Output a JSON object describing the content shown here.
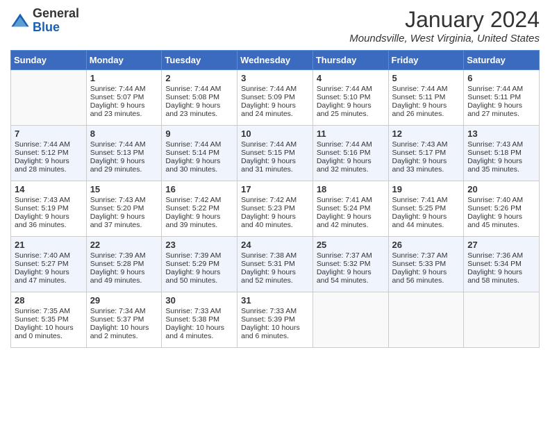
{
  "header": {
    "logo_general": "General",
    "logo_blue": "Blue",
    "month_title": "January 2024",
    "location": "Moundsville, West Virginia, United States"
  },
  "days_of_week": [
    "Sunday",
    "Monday",
    "Tuesday",
    "Wednesday",
    "Thursday",
    "Friday",
    "Saturday"
  ],
  "weeks": [
    [
      {
        "day": "",
        "empty": true
      },
      {
        "day": "1",
        "sunrise": "Sunrise: 7:44 AM",
        "sunset": "Sunset: 5:07 PM",
        "daylight": "Daylight: 9 hours and 23 minutes."
      },
      {
        "day": "2",
        "sunrise": "Sunrise: 7:44 AM",
        "sunset": "Sunset: 5:08 PM",
        "daylight": "Daylight: 9 hours and 23 minutes."
      },
      {
        "day": "3",
        "sunrise": "Sunrise: 7:44 AM",
        "sunset": "Sunset: 5:09 PM",
        "daylight": "Daylight: 9 hours and 24 minutes."
      },
      {
        "day": "4",
        "sunrise": "Sunrise: 7:44 AM",
        "sunset": "Sunset: 5:10 PM",
        "daylight": "Daylight: 9 hours and 25 minutes."
      },
      {
        "day": "5",
        "sunrise": "Sunrise: 7:44 AM",
        "sunset": "Sunset: 5:11 PM",
        "daylight": "Daylight: 9 hours and 26 minutes."
      },
      {
        "day": "6",
        "sunrise": "Sunrise: 7:44 AM",
        "sunset": "Sunset: 5:11 PM",
        "daylight": "Daylight: 9 hours and 27 minutes."
      }
    ],
    [
      {
        "day": "7",
        "sunrise": "Sunrise: 7:44 AM",
        "sunset": "Sunset: 5:12 PM",
        "daylight": "Daylight: 9 hours and 28 minutes."
      },
      {
        "day": "8",
        "sunrise": "Sunrise: 7:44 AM",
        "sunset": "Sunset: 5:13 PM",
        "daylight": "Daylight: 9 hours and 29 minutes."
      },
      {
        "day": "9",
        "sunrise": "Sunrise: 7:44 AM",
        "sunset": "Sunset: 5:14 PM",
        "daylight": "Daylight: 9 hours and 30 minutes."
      },
      {
        "day": "10",
        "sunrise": "Sunrise: 7:44 AM",
        "sunset": "Sunset: 5:15 PM",
        "daylight": "Daylight: 9 hours and 31 minutes."
      },
      {
        "day": "11",
        "sunrise": "Sunrise: 7:44 AM",
        "sunset": "Sunset: 5:16 PM",
        "daylight": "Daylight: 9 hours and 32 minutes."
      },
      {
        "day": "12",
        "sunrise": "Sunrise: 7:43 AM",
        "sunset": "Sunset: 5:17 PM",
        "daylight": "Daylight: 9 hours and 33 minutes."
      },
      {
        "day": "13",
        "sunrise": "Sunrise: 7:43 AM",
        "sunset": "Sunset: 5:18 PM",
        "daylight": "Daylight: 9 hours and 35 minutes."
      }
    ],
    [
      {
        "day": "14",
        "sunrise": "Sunrise: 7:43 AM",
        "sunset": "Sunset: 5:19 PM",
        "daylight": "Daylight: 9 hours and 36 minutes."
      },
      {
        "day": "15",
        "sunrise": "Sunrise: 7:43 AM",
        "sunset": "Sunset: 5:20 PM",
        "daylight": "Daylight: 9 hours and 37 minutes."
      },
      {
        "day": "16",
        "sunrise": "Sunrise: 7:42 AM",
        "sunset": "Sunset: 5:22 PM",
        "daylight": "Daylight: 9 hours and 39 minutes."
      },
      {
        "day": "17",
        "sunrise": "Sunrise: 7:42 AM",
        "sunset": "Sunset: 5:23 PM",
        "daylight": "Daylight: 9 hours and 40 minutes."
      },
      {
        "day": "18",
        "sunrise": "Sunrise: 7:41 AM",
        "sunset": "Sunset: 5:24 PM",
        "daylight": "Daylight: 9 hours and 42 minutes."
      },
      {
        "day": "19",
        "sunrise": "Sunrise: 7:41 AM",
        "sunset": "Sunset: 5:25 PM",
        "daylight": "Daylight: 9 hours and 44 minutes."
      },
      {
        "day": "20",
        "sunrise": "Sunrise: 7:40 AM",
        "sunset": "Sunset: 5:26 PM",
        "daylight": "Daylight: 9 hours and 45 minutes."
      }
    ],
    [
      {
        "day": "21",
        "sunrise": "Sunrise: 7:40 AM",
        "sunset": "Sunset: 5:27 PM",
        "daylight": "Daylight: 9 hours and 47 minutes."
      },
      {
        "day": "22",
        "sunrise": "Sunrise: 7:39 AM",
        "sunset": "Sunset: 5:28 PM",
        "daylight": "Daylight: 9 hours and 49 minutes."
      },
      {
        "day": "23",
        "sunrise": "Sunrise: 7:39 AM",
        "sunset": "Sunset: 5:29 PM",
        "daylight": "Daylight: 9 hours and 50 minutes."
      },
      {
        "day": "24",
        "sunrise": "Sunrise: 7:38 AM",
        "sunset": "Sunset: 5:31 PM",
        "daylight": "Daylight: 9 hours and 52 minutes."
      },
      {
        "day": "25",
        "sunrise": "Sunrise: 7:37 AM",
        "sunset": "Sunset: 5:32 PM",
        "daylight": "Daylight: 9 hours and 54 minutes."
      },
      {
        "day": "26",
        "sunrise": "Sunrise: 7:37 AM",
        "sunset": "Sunset: 5:33 PM",
        "daylight": "Daylight: 9 hours and 56 minutes."
      },
      {
        "day": "27",
        "sunrise": "Sunrise: 7:36 AM",
        "sunset": "Sunset: 5:34 PM",
        "daylight": "Daylight: 9 hours and 58 minutes."
      }
    ],
    [
      {
        "day": "28",
        "sunrise": "Sunrise: 7:35 AM",
        "sunset": "Sunset: 5:35 PM",
        "daylight": "Daylight: 10 hours and 0 minutes."
      },
      {
        "day": "29",
        "sunrise": "Sunrise: 7:34 AM",
        "sunset": "Sunset: 5:37 PM",
        "daylight": "Daylight: 10 hours and 2 minutes."
      },
      {
        "day": "30",
        "sunrise": "Sunrise: 7:33 AM",
        "sunset": "Sunset: 5:38 PM",
        "daylight": "Daylight: 10 hours and 4 minutes."
      },
      {
        "day": "31",
        "sunrise": "Sunrise: 7:33 AM",
        "sunset": "Sunset: 5:39 PM",
        "daylight": "Daylight: 10 hours and 6 minutes."
      },
      {
        "day": "",
        "empty": true
      },
      {
        "day": "",
        "empty": true
      },
      {
        "day": "",
        "empty": true
      }
    ]
  ]
}
